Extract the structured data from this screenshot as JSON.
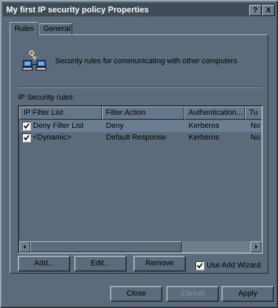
{
  "window": {
    "title": "My first IP security policy Properties",
    "help_button": "?",
    "close_button": "X"
  },
  "tabs": [
    {
      "label": "Rules",
      "active": true
    },
    {
      "label": "General",
      "active": false
    }
  ],
  "rules_tab": {
    "description": "Security rules for communicating with other computers",
    "list_label": "IP Security rules:",
    "columns": [
      "IP Filter List",
      "Filter Action",
      "Authentication...",
      "Tu"
    ],
    "rows": [
      {
        "checked": true,
        "filter_list": "Deny Filter List",
        "filter_action": "Deny",
        "authentication": "Kerberos",
        "tunnel": "No",
        "selected": true
      },
      {
        "checked": true,
        "filter_list": "<Dynamic>",
        "filter_action": "Default Response",
        "authentication": "Kerberos",
        "tunnel": "No",
        "selected": false
      }
    ],
    "add_button": "Add...",
    "edit_button": "Edit...",
    "remove_button": "Remove",
    "use_wizard_label": "Use Add Wizard",
    "use_wizard_checked": true
  },
  "footer": {
    "close_button": "Close",
    "cancel_button": "Cancel",
    "apply_button": "Apply"
  }
}
